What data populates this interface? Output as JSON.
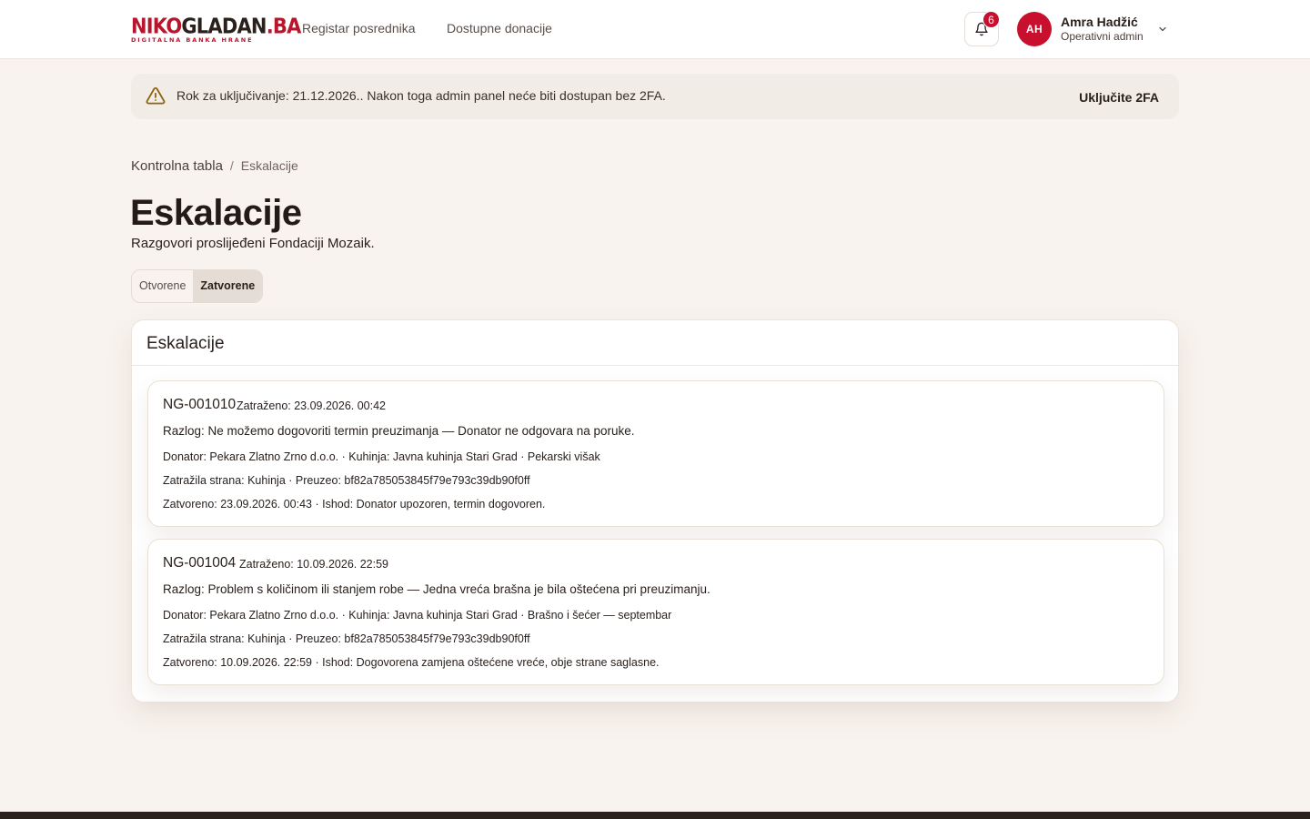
{
  "header": {
    "logo": {
      "part1": "NIKO",
      "part2": "GLADAN",
      "part3": ".BA",
      "tagline": "DIGITALNA BANKA HRANE"
    },
    "nav": [
      {
        "label": "Registar posrednika"
      },
      {
        "label": "Dostupne donacije"
      }
    ],
    "notifications_count": "6",
    "user": {
      "initials": "AH",
      "name": "Amra Hadžić",
      "role": "Operativni admin"
    }
  },
  "banner": {
    "text": "Rok za uključivanje: 21.12.2026.. Nakon toga admin panel neće biti dostupan bez 2FA.",
    "button_label": "Uključite 2FA",
    "icon": "warning-icon"
  },
  "breadcrumb": {
    "home": "Kontrolna tabla",
    "separator": "/",
    "current": "Eskalacije"
  },
  "page": {
    "title": "Eskalacije",
    "subtitle": "Razgovori proslijeđeni Fondaciji Mozaik."
  },
  "tabs": [
    {
      "label": "Otvorene",
      "active": false
    },
    {
      "label": "Zatvorene",
      "active": true
    }
  ],
  "card": {
    "title": "Eskalacije",
    "items": [
      {
        "id": "NG-001010",
        "requested": "Zatraženo: 23.09.2026. 00:42",
        "reason": "Razlog: Ne možemo dogovoriti termin preuzimanja — Donator ne odgovara na poruke.",
        "donor_line": "Donator: Pekara Zlatno Zrno d.o.o. · Kuhinja: Javna kuhinja Stari Grad · Pekarski višak",
        "party_line": "Zatražila strana: Kuhinja · Preuzeo: bf82a785053845f79e793c39db90f0ff",
        "closed_line": "Zatvoreno: 23.09.2026. 00:43 · Ishod: Donator upozoren, termin dogovoren."
      },
      {
        "id": "NG-001004",
        "requested": "Zatraženo: 10.09.2026. 22:59",
        "reason": "Razlog: Problem s količinom ili stanjem robe — Jedna vreća brašna je bila oštećena pri preuzimanju.",
        "donor_line": "Donator: Pekara Zlatno Zrno d.o.o. · Kuhinja: Javna kuhinja Stari Grad · Brašno i šećer — septembar",
        "party_line": "Zatražila strana: Kuhinja · Preuzeo: bf82a785053845f79e793c39db90f0ff",
        "closed_line": "Zatvoreno: 10.09.2026. 22:59 · Ishod: Dogovorena zamjena oštećene vreće, obje strane saglasne."
      }
    ]
  },
  "colors": {
    "brand": "#c8102e",
    "background": "#f8f3ee",
    "text": "#2a201c"
  }
}
